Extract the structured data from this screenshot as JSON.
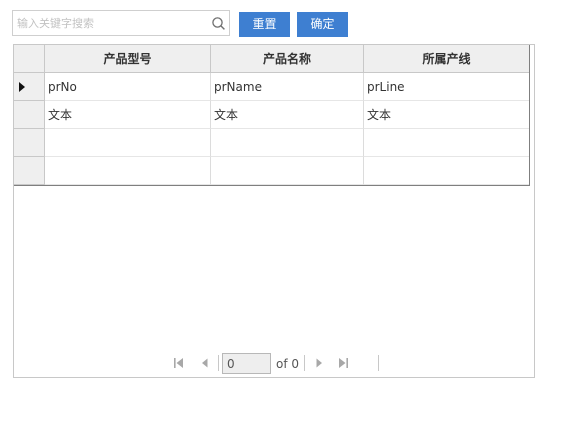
{
  "search": {
    "placeholder": "输入关键字搜索",
    "value": ""
  },
  "toolbar": {
    "reset_label": "重置",
    "confirm_label": "确定"
  },
  "grid": {
    "columns": [
      "产品型号",
      "产品名称",
      "所属产线"
    ],
    "rows": [
      [
        "prNo",
        "prName",
        "prLine"
      ],
      [
        "文本",
        "文本",
        "文本"
      ],
      [
        "",
        "",
        ""
      ],
      [
        "",
        "",
        ""
      ]
    ],
    "current_row": 0
  },
  "pager": {
    "page": "0",
    "total_text": "of 0"
  },
  "colors": {
    "button": "#3e7fd1",
    "header_bg": "#efefef"
  }
}
